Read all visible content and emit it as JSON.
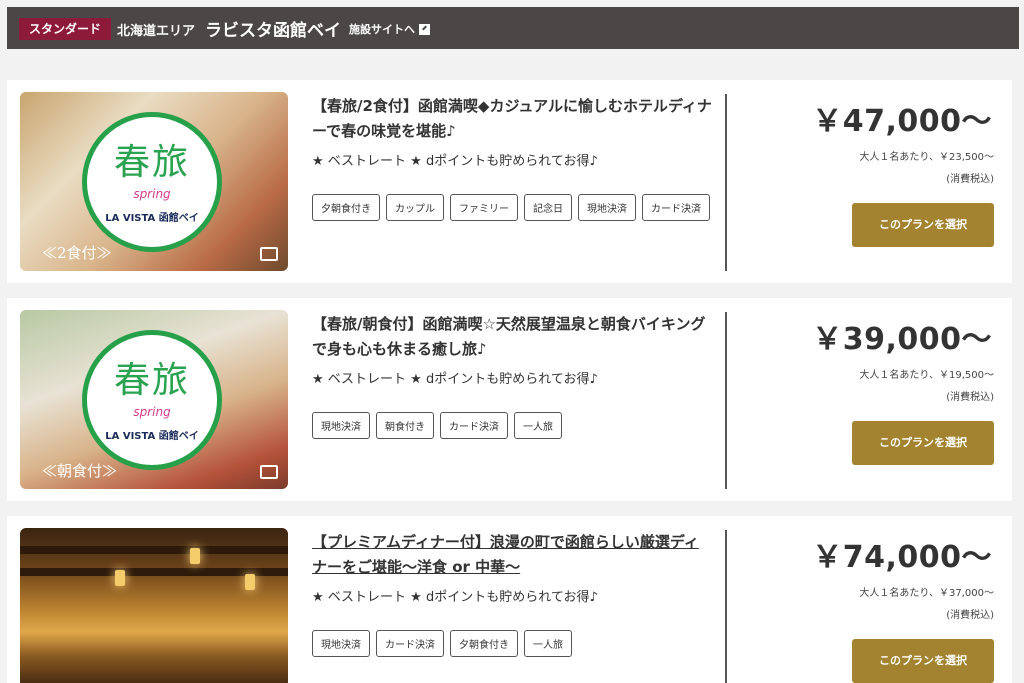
{
  "header": {
    "badge": "スタンダード",
    "area": "北海道エリア",
    "hotel": "ラビスタ函館ベイ",
    "site_link": "施設サイトへ"
  },
  "plans": [
    {
      "title": "【春旅/2食付】函館満喫◆カジュアルに愉しむホテルディナーで春の味覚を堪能♪",
      "best_rate": "★ ベストレート ★ dポイントも貯められてお得♪",
      "tags": [
        "夕朝食付き",
        "カップル",
        "ファミリー",
        "記念日",
        "現地決済",
        "カード決済"
      ],
      "image_caption": "≪2食付≫",
      "price": "￥47,000～",
      "per_person": "大人１名あたり、￥23,500～",
      "tax_note": "(消費税込)",
      "button": "このプランを選択"
    },
    {
      "title": "【春旅/朝食付】函館満喫☆天然展望温泉と朝食バイキングで身も心も休まる癒し旅♪",
      "best_rate": "★ ベストレート ★ dポイントも貯められてお得♪",
      "tags": [
        "現地決済",
        "朝食付き",
        "カード決済",
        "一人旅"
      ],
      "image_caption": "≪朝食付≫",
      "price": "￥39,000～",
      "per_person": "大人１名あたり、￥19,500～",
      "tax_note": "(消費税込)",
      "button": "このプランを選択"
    },
    {
      "title": "【プレミアムディナー付】浪漫の町で函館らしい厳選ディナーをご堪能～洋食 or 中華～",
      "best_rate": "★ ベストレート ★ dポイントも貯められてお得♪",
      "tags": [
        "現地決済",
        "カード決済",
        "夕朝食付き",
        "一人旅"
      ],
      "price": "￥74,000～",
      "per_person": "大人１名あたり、￥37,000～",
      "tax_note": "(消費税込)",
      "button": "このプランを選択"
    }
  ],
  "poster": {
    "headline": "春旅",
    "sub": "spring",
    "brand": "LA VISTA 函館ベイ"
  }
}
